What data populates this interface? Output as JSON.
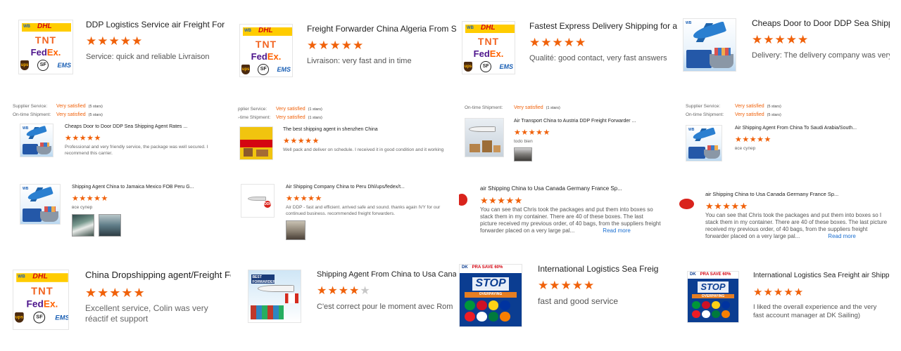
{
  "columns": [
    {
      "big_top": {
        "title": "DDP Logistics Service air Freight For",
        "stars": "★★★★★",
        "comment_label": "Service:",
        "comment_text": "quick and reliable Livraison"
      },
      "satisfaction": [
        {
          "label": "Supplier Service:",
          "value": "Very satisfied",
          "count": "(5 stars)"
        },
        {
          "label": "On-time Shipment:",
          "value": "Very satisfied",
          "count": "(5 stars)"
        }
      ],
      "small_1": {
        "title": "Cheaps Door to Door DDP Sea Shipping Agent Rates ...",
        "stars": "★★★★★",
        "comment": "Professional and very friendly service, the package was well secured. I recommend this carrier."
      },
      "small_2": {
        "title": "Shipping Agent China to Jamaica Mexico FOB Peru G...",
        "stars": "★★★★★",
        "comment": "все супер"
      },
      "big_bottom": {
        "title": "China Dropshipping agent/Freight For",
        "stars": "★★★★★",
        "comment": "Excellent service, Colin was very réactif et support"
      }
    },
    {
      "big_top": {
        "title": "Freight Forwarder China Algeria From She",
        "stars": "★★★★★",
        "comment_label": "Livraison:",
        "comment_text": "very fast and in time"
      },
      "satisfaction": [
        {
          "label": "Supplier Service:",
          "value": "Very satisfied",
          "count": "(1 stars)"
        },
        {
          "label": "On-time Shipment:",
          "value": "Very satisfied",
          "count": "(1 stars)"
        }
      ],
      "small_1": {
        "title": "The best shipping agent in shenzhen China",
        "stars": "★★★★★",
        "comment": "Well pack and deliver on schedule. I received it in good condition and it working"
      },
      "small_2": {
        "title": "Air Shipping Company China to Peru Dhl/ups/fedex/t...",
        "stars": "★★★★★",
        "comment": "Air DDP - fast and efficient. arrived safe and sound. thanks again IVY for our continued business. recommended freight forwarders."
      },
      "big_bottom": {
        "title": "Shipping Agent From China to Usa Cana",
        "stars_on": "★★★★",
        "stars_off": "★",
        "comment": "C'est correct pour le moment avec Rom"
      }
    },
    {
      "big_top": {
        "title": "Fastest Express Delivery Shipping for am",
        "stars": "★★★★★",
        "comment_label": "Qualité:",
        "comment_text": "good contact, very fast answers"
      },
      "satisfaction": [
        {
          "label": "On-time Shipment:",
          "value": "Very satisfied",
          "count": "(1 stars)"
        }
      ],
      "small_1": {
        "title": "Air Transport China to Austria DDP Freight Forwarder ...",
        "stars": "★★★★★",
        "comment": "todo bien"
      },
      "small_2": {
        "title": "air Shipping China to Usa Canada Germany France Sp...",
        "stars": "★★★★★",
        "comment": "You can see that Chris took the packages and put them into boxes so stack them in my container. There are 40 of these boxes. The last picture received my previous order, of 40 bags, from the suppliers freight forwarder placed on a very large pal...",
        "read_more": "Read more"
      },
      "big_bottom": {
        "title": "International Logistics Sea Freig",
        "stars": "★★★★★",
        "comment": "fast and good service"
      }
    },
    {
      "big_top": {
        "title": "Cheaps Door to Door DDP Sea Shipping A",
        "stars": "★★★★★",
        "comment_label": "Delivery:",
        "comment_text": "The delivery company was very"
      },
      "satisfaction": [
        {
          "label": "Supplier Service:",
          "value": "Very satisfied",
          "count": "(5 stars)"
        },
        {
          "label": "On-time Shipment:",
          "value": "Very satisfied",
          "count": "(5 stars)"
        }
      ],
      "small_1": {
        "title": "Air Shipping Agent From China To Saudi Arabia/South...",
        "stars": "★★★★★",
        "comment": "все супер"
      },
      "small_2": {
        "title": "air Shipping China to Usa Canada Germany France Sp...",
        "stars": "★★★★★",
        "comment": "You can see that Chris took the packages and put them into boxes so I stack them in my container. There are 40 of these boxes. The last picture received my previous order, of 40 bags, from the suppliers freight forwarder placed on a very large pal...",
        "read_more": "Read more"
      },
      "big_bottom": {
        "title": "International Logistics Sea Freight air Shipp",
        "stars": "★★★★★",
        "comment": "I liked the overall experience and the very fast account manager at DK Sailing)"
      }
    }
  ],
  "logos": {
    "dhl": "DHL",
    "dhl_tag": "WB",
    "tnt": "TNT",
    "fedex_fe": "Fed",
    "fedex_ex": "Ex.",
    "ups": "ups",
    "sf": "SF",
    "ems": "EMS",
    "wb": "WB",
    "dk_brand": "DK",
    "dk_sale": "PRA SAVE 60%",
    "dk_stop": "STOP",
    "dk_ribbon": "OVERPAYING",
    "forwarder_sign": "BEST FORWARDER",
    "badge": "DDP"
  },
  "colors": {
    "accent_orange": "#f0610a",
    "link_blue": "#1a6fd1",
    "star_off": "#c8c8c8"
  }
}
